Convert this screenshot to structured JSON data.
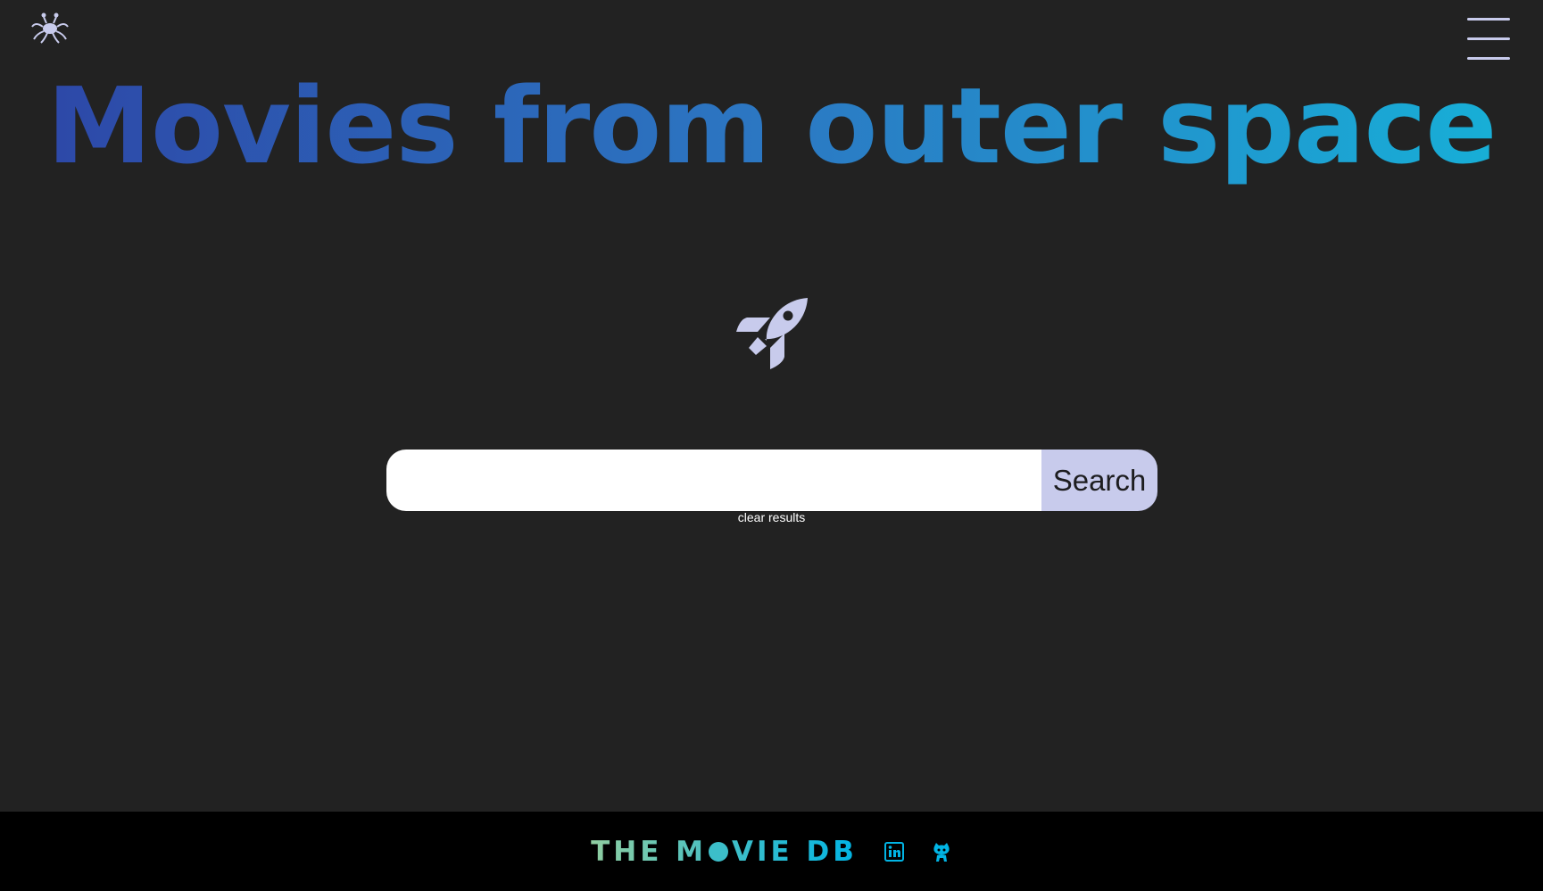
{
  "header": {
    "logo_icon": "flying-spaghetti-monster-icon",
    "menu_icon": "hamburger-menu-icon",
    "title": "Movies from outer space"
  },
  "hero": {
    "icon": "rocket-icon"
  },
  "search": {
    "input_value": "",
    "placeholder": "",
    "button_label": "Search",
    "clear_label": "clear results"
  },
  "footer": {
    "brand_part1": "THE M",
    "brand_part2": "VIE DB",
    "icons": [
      "linkedin-icon",
      "github-icon"
    ]
  },
  "colors": {
    "background": "#222222",
    "footer_background": "#000000",
    "accent_lavender": "#c8cbec",
    "title_gradient_start": "#2d45a6",
    "title_gradient_end": "#16b2d8",
    "footer_icon": "#01b4e4"
  }
}
